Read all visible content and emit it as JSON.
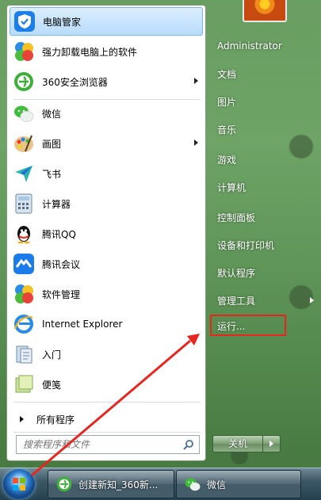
{
  "start_menu": {
    "programs": [
      {
        "label": "电脑管家",
        "icon": "shield-icon",
        "has_submenu": false
      },
      {
        "label": "强力卸载电脑上的软件",
        "icon": "uninstall-icon",
        "has_submenu": false
      },
      {
        "label": "360安全浏览器",
        "icon": "360-browser-icon",
        "has_submenu": true
      },
      {
        "label": "微信",
        "icon": "wechat-icon",
        "has_submenu": false
      },
      {
        "label": "画图",
        "icon": "paint-icon",
        "has_submenu": true
      },
      {
        "label": "飞书",
        "icon": "feishu-icon",
        "has_submenu": false
      },
      {
        "label": "计算器",
        "icon": "calculator-icon",
        "has_submenu": false
      },
      {
        "label": "腾讯QQ",
        "icon": "qq-icon",
        "has_submenu": false
      },
      {
        "label": "腾讯会议",
        "icon": "tencent-meeting-icon",
        "has_submenu": false
      },
      {
        "label": "软件管理",
        "icon": "software-manager-icon",
        "has_submenu": false
      },
      {
        "label": "Internet Explorer",
        "icon": "internet-explorer-icon",
        "has_submenu": false
      },
      {
        "label": "入门",
        "icon": "getting-started-icon",
        "has_submenu": false
      },
      {
        "label": "便笺",
        "icon": "sticky-notes-icon",
        "has_submenu": false
      }
    ],
    "all_programs_label": "所有程序",
    "search": {
      "placeholder": "搜索程序和文件"
    },
    "right_items": [
      {
        "label": "Administrator",
        "has_submenu": false
      },
      {
        "label": "文档",
        "has_submenu": false
      },
      {
        "label": "图片",
        "has_submenu": false
      },
      {
        "label": "音乐",
        "has_submenu": false
      },
      {
        "label": "游戏",
        "has_submenu": false
      },
      {
        "label": "计算机",
        "has_submenu": false
      },
      {
        "label": "控制面板",
        "has_submenu": false
      },
      {
        "label": "设备和打印机",
        "has_submenu": false
      },
      {
        "label": "默认程序",
        "has_submenu": false
      },
      {
        "label": "管理工具",
        "has_submenu": true
      },
      {
        "label": "运行...",
        "has_submenu": false
      }
    ],
    "shutdown_label": "关机"
  },
  "taskbar": {
    "buttons": [
      {
        "label": "创建新知_360新...",
        "icon": "360-browser-icon"
      },
      {
        "label": "微信",
        "icon": "wechat-icon"
      }
    ]
  },
  "colors": {
    "highlight": "#b9dcfb",
    "annotation": "#e8251e"
  }
}
